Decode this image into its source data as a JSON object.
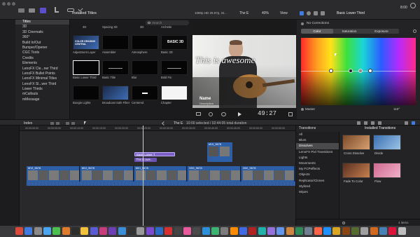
{
  "toolbar": {
    "browser_title": "Installed Titles",
    "resolution": "1080p HD 29.97p, St...",
    "project": "The E",
    "zoom": "40%",
    "view": "View",
    "inspector_title": "Basic Lower Third",
    "timecode": "8:00"
  },
  "library": {
    "items": [
      {
        "label": "Titles",
        "selected": true
      },
      {
        "label": "3D"
      },
      {
        "label": "3D Cinematic"
      },
      {
        "label": "360°"
      },
      {
        "label": "Build In/Out"
      },
      {
        "label": "Bumper/Opener"
      },
      {
        "label": "CGC Tools"
      },
      {
        "label": "Credits"
      },
      {
        "label": "Elements"
      },
      {
        "label": "LenoFX Cle...ner Third"
      },
      {
        "label": "LenoFX Bullet Points"
      },
      {
        "label": "LenoFX Minimal Titles"
      },
      {
        "label": "LenoFX Sl...wer Third"
      },
      {
        "label": "Lower Thirds"
      },
      {
        "label": "mCallouts"
      },
      {
        "label": "mMessage"
      }
    ]
  },
  "browser": {
    "search_placeholder": "Search",
    "top_captions": [
      "3D",
      "Spacing 3D",
      "3D",
      "Archetie"
    ],
    "titles": [
      {
        "label": "Adjustment Layer"
      },
      {
        "label": "Assembler"
      },
      {
        "label": "Atmosphere"
      },
      {
        "label": "Basic 3D"
      },
      {
        "label": "Basic Lower Third"
      },
      {
        "label": "Basic Title"
      },
      {
        "label": "Blur"
      },
      {
        "label": "Bold Fin"
      },
      {
        "label": "Boogie Lights"
      },
      {
        "label": "Broadcast Safe Filter"
      },
      {
        "label": "Centered"
      },
      {
        "label": "Chapter"
      }
    ],
    "thumb_texts": {
      "basic3d": "BASIC 3D",
      "adjust": "COLOR GRADING CENTRAL"
    }
  },
  "viewer": {
    "overlay_text": "This is awesome",
    "name_text": "Name",
    "desc_text": "Description",
    "timecode": "49:27"
  },
  "inspector": {
    "corrections": "No Corrections",
    "tabs": [
      "Color",
      "Saturation",
      "Exposure"
    ],
    "master_label": "Master",
    "master_value": "110°"
  },
  "timeline": {
    "index_label": "Index",
    "project_name": "The E",
    "status": "10:00 selected / 02:44:05 total duration",
    "ruler": [
      "00:00:00:00",
      "00:00:05:00",
      "00:00:10:00",
      "00:00:15:00",
      "00:00:20:00",
      "00:00:25:00",
      "00:00:30:00",
      "00:00:35:00",
      "00:00:40:00",
      "00:00:45:00",
      "00:00:50:00",
      "00:00:55:00"
    ],
    "title_clip": "Basic Lower T",
    "title_clip2": "This is awe...",
    "broll_clip": "MVI_9678",
    "main_clips": [
      "MVI_9678",
      "MVI_9678",
      "MVI_9678",
      "MVI_9678",
      "MVI_9678"
    ]
  },
  "transitions": {
    "title": "Transitions",
    "installed": "Installed Transitions",
    "categories": [
      {
        "label": "All"
      },
      {
        "label": "Blurs"
      },
      {
        "label": "Dissolves",
        "selected": true
      },
      {
        "label": "LenoFX Pixl Transitions"
      },
      {
        "label": "Lights"
      },
      {
        "label": "Movements"
      },
      {
        "label": "My FCPeffects"
      },
      {
        "label": "Objects"
      },
      {
        "label": "Replicator/Clones"
      },
      {
        "label": "Stylized"
      },
      {
        "label": "Wipes"
      }
    ],
    "items": [
      {
        "label": "Cross Dissolve"
      },
      {
        "label": "Divide"
      },
      {
        "label": "Fade To Color"
      },
      {
        "label": "Flow"
      }
    ],
    "count": "4 items"
  },
  "dock": {
    "app_colors": [
      "#d94a3b",
      "#3f7be0",
      "#8a8a8a",
      "#4aa6f0",
      "#4bc04e",
      "#e07b2c",
      "#2d2d2d",
      "#f3c13a",
      "#5b5bd6",
      "#c73d7c",
      "#6c3fb5",
      "#3a8fd8",
      "#333",
      "#999",
      "#7a4bd0",
      "#2a6bc8",
      "#d83030",
      "#444",
      "#e85a9c",
      "#4a4a4a",
      "#2c8fd9",
      "#3cb371",
      "#7c7c7c",
      "#ff8c00",
      "#4169e1",
      "#b22222",
      "#20b2aa",
      "#9370db",
      "#6495ed",
      "#cd853f",
      "#2e8b57",
      "#708090",
      "#ff6347",
      "#1e90ff",
      "#daa520",
      "#8b4513",
      "#556b2f",
      "#a0a0a0",
      "#d2691e",
      "#4682b4",
      "#dc143c",
      "#bdbdbd"
    ]
  },
  "colors": {
    "accent": "#3f7be0",
    "title_clip": "#7b5fc7",
    "video_clip": "#2d5fa8"
  }
}
